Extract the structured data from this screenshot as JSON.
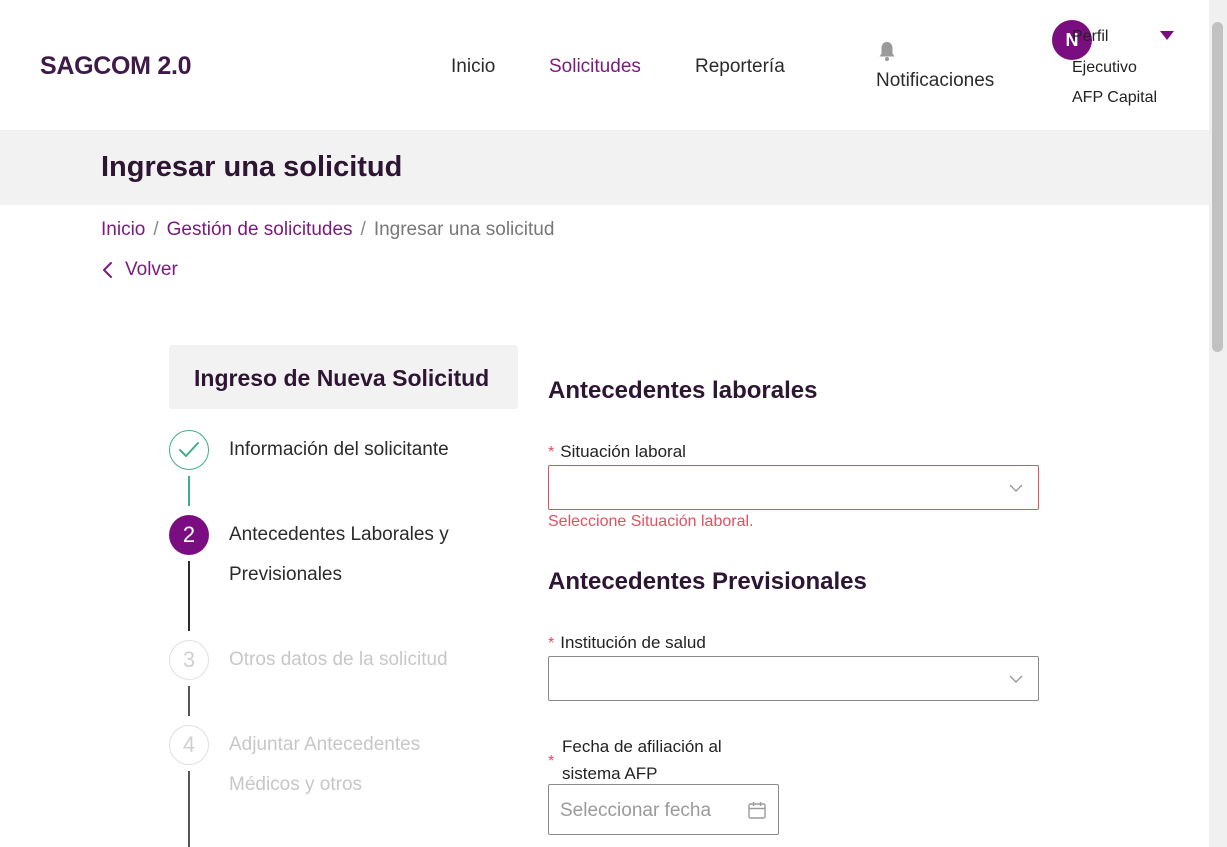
{
  "header": {
    "brand": "SAGCOM 2.0",
    "nav": [
      {
        "label": "Inicio",
        "active": false
      },
      {
        "label": "Solicitudes",
        "active": true
      },
      {
        "label": "Reportería",
        "active": false
      }
    ],
    "notifications_label": "Notificaciones",
    "notifications_icon": "bell-icon",
    "profile": {
      "avatar_initial": "N",
      "title": "Perfil",
      "role": "Ejecutivo",
      "organization": "AFP Capital"
    }
  },
  "page_title": "Ingresar una solicitud",
  "breadcrumb": {
    "items": [
      "Inicio",
      "Gestión de solicitudes"
    ],
    "separator": "/",
    "current": "Ingresar una solicitud"
  },
  "back_label": "Volver",
  "stepper": {
    "title": "Ingreso de Nueva Solicitud",
    "steps": [
      {
        "number": "1",
        "label": "Información del solicitante",
        "status": "done"
      },
      {
        "number": "2",
        "label_line1": "Antecedentes Laborales y",
        "label_line2": "Previsionales",
        "status": "current"
      },
      {
        "number": "3",
        "label": "Otros datos de la solicitud",
        "status": "pending"
      },
      {
        "number": "4",
        "label_line1": "Adjuntar Antecedentes",
        "label_line2": "Médicos y otros",
        "status": "pending"
      }
    ]
  },
  "form": {
    "required_mark": "*",
    "section_laborales": "Antecedentes laborales",
    "situacion_label": "Situación laboral",
    "situacion_value": "",
    "situacion_error": "Seleccione Situación laboral.",
    "section_previsionales": "Antecedentes Previsionales",
    "salud_label": "Institución de salud",
    "salud_value": "",
    "fecha_label": "Fecha de afiliación al sistema AFP",
    "fecha_placeholder": "Seleccionar fecha"
  },
  "colors": {
    "primary": "#7a0e80",
    "title": "#2e1533",
    "error": "#e0505f",
    "success": "#3fae8a",
    "band": "#f2f2f2"
  }
}
